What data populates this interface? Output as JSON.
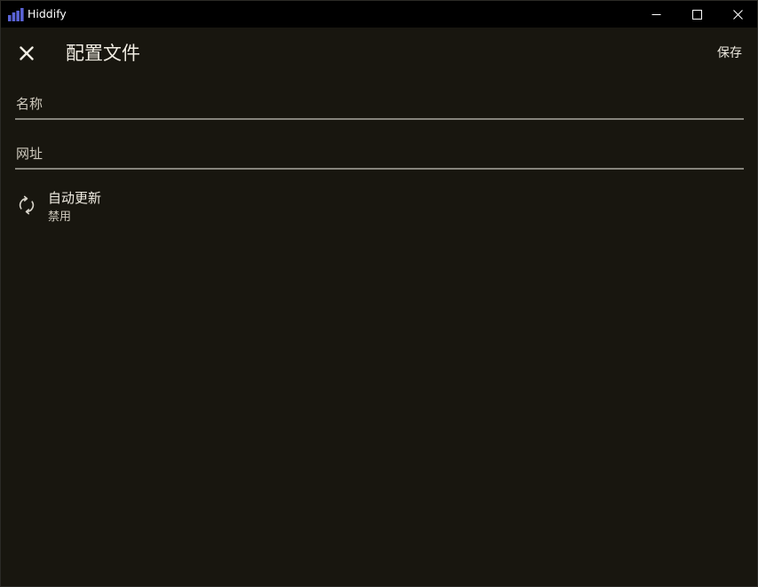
{
  "window": {
    "title": "Hiddify",
    "logo_color": "#5a63d6"
  },
  "appbar": {
    "close_icon": "close-icon",
    "title": "配置文件",
    "save_label": "保存"
  },
  "form": {
    "name_label": "名称",
    "url_label": "网址"
  },
  "auto_update": {
    "icon": "sync-icon",
    "title": "自动更新",
    "status": "禁用"
  }
}
